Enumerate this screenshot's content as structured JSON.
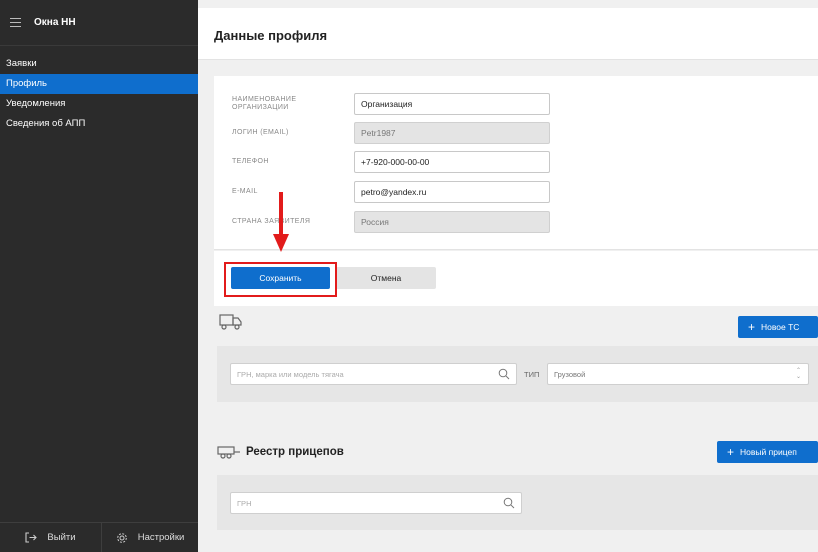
{
  "app": {
    "title": "Окна НН"
  },
  "sidebar": {
    "items": [
      {
        "label": "Заявки",
        "active": false
      },
      {
        "label": "Профиль",
        "active": true
      },
      {
        "label": "Уведомления",
        "active": false
      },
      {
        "label": "Сведения об АПП",
        "active": false
      }
    ],
    "logout_label": "Выйти",
    "settings_label": "Настройки"
  },
  "header": {
    "title": "Данные профиля"
  },
  "form": {
    "org_label": "НАИМЕНОВАНИЕ ОРГАНИЗАЦИИ",
    "org_value": "Организация",
    "login_label": "ЛОГИН (EMAIL)",
    "login_value": "Petr1987",
    "phone_label": "ТЕЛЕФОН",
    "phone_value": "+7-920-000-00-00",
    "email_label": "E-MAIL",
    "email_value": "petro@yandex.ru",
    "country_label": "СТРАНА ЗАЯВИТЕЛЯ",
    "country_value": "Россия"
  },
  "actions": {
    "save_label": "Сохранить",
    "cancel_label": "Отмена"
  },
  "vehicles": {
    "add_label": "Новое ТС",
    "search_placeholder": "ГРН, марка или модель тягача",
    "type_label": "ТИП",
    "type_value": "Грузовой"
  },
  "trailers": {
    "title": "Реестр прицепов",
    "add_label": "Новый прицеп",
    "search_placeholder": "ГРН"
  },
  "colors": {
    "accent": "#0f6ecd",
    "sidebar": "#2b2b2b",
    "highlight": "#e21b1b"
  }
}
